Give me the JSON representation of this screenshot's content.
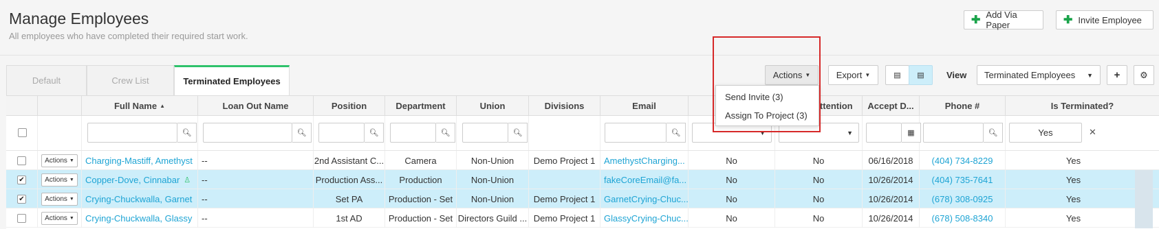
{
  "header": {
    "title": "Manage Employees",
    "subtitle": "All employees who have completed their required start work.",
    "add_via_paper": "Add Via Paper",
    "invite_employee": "Invite Employee"
  },
  "tabs": [
    "Default",
    "Crew List",
    "Terminated Employees"
  ],
  "toolbar": {
    "actions": "Actions",
    "export": "Export",
    "view_label": "View",
    "view_value": "Terminated Employees"
  },
  "actions_menu": [
    "Send Invite (3)",
    "Assign To Project (3)"
  ],
  "columns": [
    "Full Name",
    "Loan Out Name",
    "Position",
    "Department",
    "Union",
    "Divisions",
    "Email",
    "Needs Attention",
    "Accept D...",
    "Phone #",
    "Is Terminated?"
  ],
  "filters": {
    "is_terminated": "Yes"
  },
  "row_action_label": "Actions",
  "rows": [
    {
      "name": "Charging-Mastiff, Amethyst",
      "loan_out": "--",
      "position": "2nd Assistant C...",
      "department": "Camera",
      "union": "Non-Union",
      "divisions": "Demo Project 1",
      "email": "AmethystCharging...",
      "col_a": "No",
      "needs_attention": "No",
      "accept": "06/16/2018",
      "phone": "(404) 734-8229",
      "terminated": "Yes",
      "selected": false
    },
    {
      "name": "Copper-Dove, Cinnabar",
      "loan_out": "--",
      "position": "Production Ass...",
      "department": "Production",
      "union": "Non-Union",
      "divisions": "",
      "email": "fakeCoreEmail@fa...",
      "col_a": "No",
      "needs_attention": "No",
      "accept": "10/26/2014",
      "phone": "(404) 735-7641",
      "terminated": "Yes",
      "selected": true
    },
    {
      "name": "Crying-Chuckwalla, Garnet",
      "loan_out": "--",
      "position": "Set PA",
      "department": "Production - Set",
      "union": "Non-Union",
      "divisions": "Demo Project 1",
      "email": "GarnetCrying-Chuc...",
      "col_a": "No",
      "needs_attention": "No",
      "accept": "10/26/2014",
      "phone": "(678) 308-0925",
      "terminated": "Yes",
      "selected": true
    },
    {
      "name": "Crying-Chuckwalla, Glassy",
      "loan_out": "--",
      "position": "1st AD",
      "department": "Production - Set",
      "union": "Directors Guild ...",
      "divisions": "Demo Project 1",
      "email": "GlassyCrying-Chuc...",
      "col_a": "No",
      "needs_attention": "No",
      "accept": "10/26/2014",
      "phone": "(678) 508-8340",
      "terminated": "Yes",
      "selected": false
    }
  ],
  "colors": {
    "accent": "#1ea4d4",
    "green": "#2ec26b",
    "selected_row": "#cdeefa",
    "highlight": "#d62828"
  }
}
